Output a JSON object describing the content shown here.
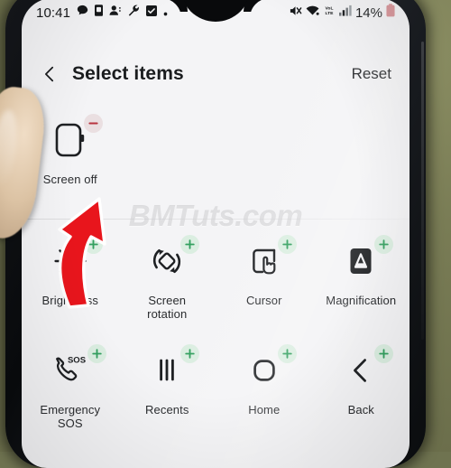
{
  "status_bar": {
    "time": "10:41",
    "battery_percent": "14%",
    "left_icons": [
      "message-icon",
      "sim-card-icon",
      "contact-icon",
      "wrench-icon",
      "checkbox-icon",
      "dot-icon"
    ],
    "right_icons": [
      "mute-icon",
      "wifi-icon",
      "volte-icon",
      "signal-bars-icon",
      "battery-icon"
    ],
    "volte_label": "VoLTE",
    "battery_color": "#d58d92"
  },
  "header": {
    "back_icon": "chevron-left-icon",
    "title": "Select items",
    "reset_label": "Reset"
  },
  "watermark": {
    "text": "BMTuts.com"
  },
  "annotation": {
    "arrow": "red-curved-arrow-up",
    "color": "#e8151c"
  },
  "colors": {
    "add_badge_bg": "#dbeee1",
    "add_badge_fg": "#33a05f",
    "remove_badge_bg": "#eadfe1",
    "remove_badge_fg": "#b8353f",
    "screen_bg": "#f4f4f6",
    "text": "#2a2c2f"
  },
  "selected_items": [
    {
      "label": "Screen off",
      "icon": "screen-off-icon",
      "badge": "remove"
    }
  ],
  "available_items": [
    {
      "label": "Brightness",
      "icon": "brightness-icon",
      "badge": "add"
    },
    {
      "label": "Screen rotation",
      "icon": "screen-rotation-icon",
      "badge": "add"
    },
    {
      "label": "Cursor",
      "icon": "cursor-icon",
      "badge": "add"
    },
    {
      "label": "Magnification",
      "icon": "magnification-icon",
      "badge": "add"
    },
    {
      "label": "Emergency SOS",
      "icon": "emergency-sos-icon",
      "badge": "add"
    },
    {
      "label": "Recents",
      "icon": "recents-icon",
      "badge": "add"
    },
    {
      "label": "Home",
      "icon": "home-icon",
      "badge": "add"
    },
    {
      "label": "Back",
      "icon": "back-icon",
      "badge": "add"
    }
  ]
}
